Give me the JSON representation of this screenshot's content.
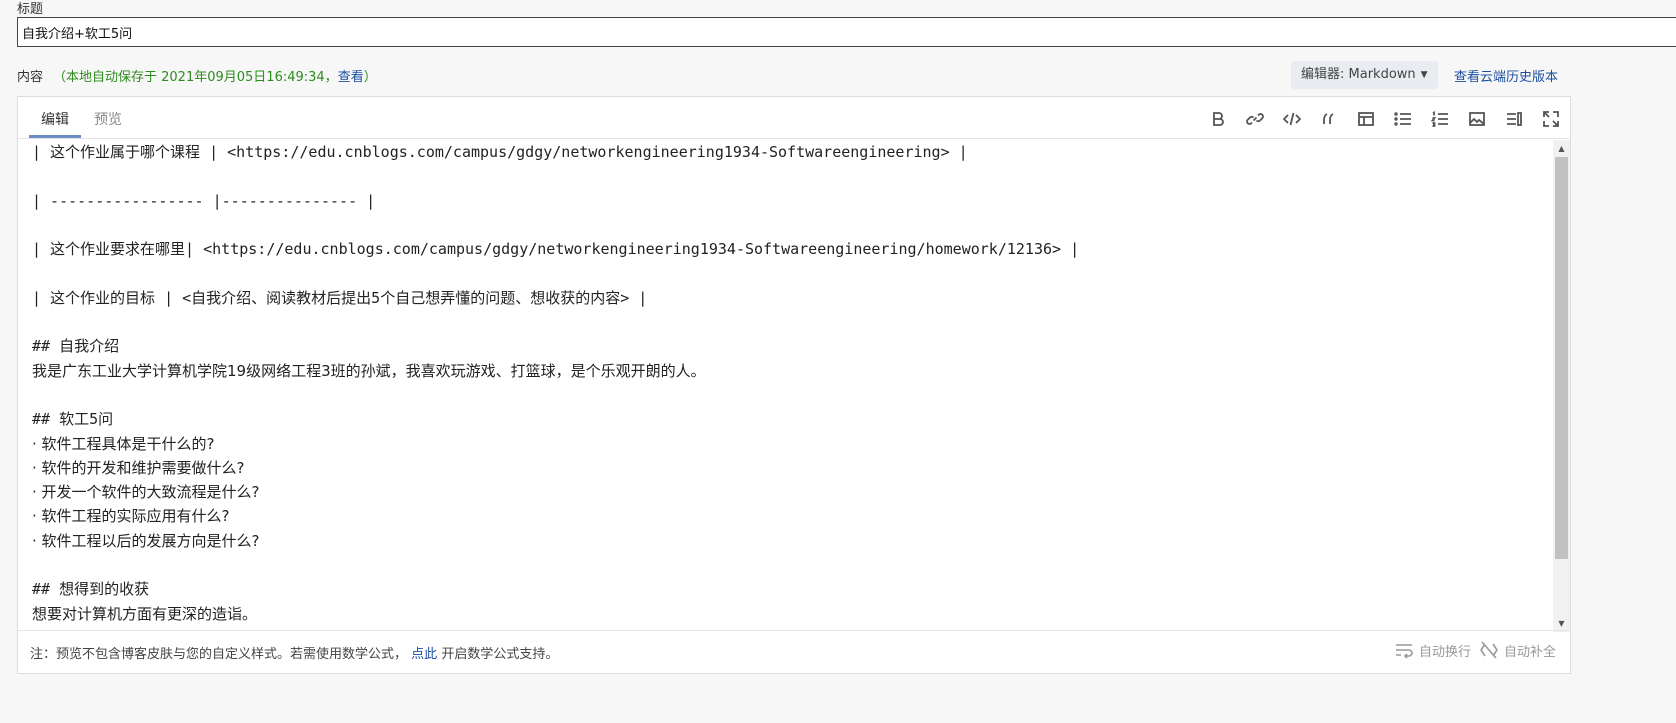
{
  "title_field": {
    "label": "标题",
    "value": "自我介绍+软工5问"
  },
  "content_header": {
    "label": "内容",
    "autosave_prefix": "（本地自动保存于 2021年09月05日16:49:34，",
    "autosave_link": "查看",
    "autosave_suffix": "）",
    "editor_select": "编辑器: Markdown",
    "history_link": "查看云端历史版本"
  },
  "editor": {
    "tabs": [
      {
        "label": "编辑",
        "active": true
      },
      {
        "label": "预览",
        "active": false
      }
    ],
    "toolbar_icons": [
      "bold-icon",
      "link-icon",
      "code-icon",
      "quote-icon",
      "table-icon",
      "bullet-list-icon",
      "numbered-list-icon",
      "image-icon",
      "split-view-icon",
      "fullscreen-icon"
    ],
    "lines": [
      "| 这个作业属于哪个课程 | <https://edu.cnblogs.com/campus/gdgy/networkengineering1934-Softwareengineering> |",
      "",
      "| ----------------- |--------------- |",
      "",
      "| 这个作业要求在哪里| <https://edu.cnblogs.com/campus/gdgy/networkengineering1934-Softwareengineering/homework/12136> |",
      "",
      "| 这个作业的目标 | <自我介绍、阅读教材后提出5个自己想弄懂的问题、想收获的内容> |",
      "",
      "## 自我介绍",
      "我是广东工业大学计算机学院19级网络工程3班的孙斌，我喜欢玩游戏、打篮球，是个乐观开朗的人。",
      "",
      "## 软工5问",
      "· 软件工程具体是干什么的?",
      "· 软件的开发和维护需要做什么?",
      "· 开发一个软件的大致流程是什么?",
      "· 软件工程的实际应用有什么?",
      "· 软件工程以后的发展方向是什么?",
      "",
      "## 想得到的收获",
      "想要对计算机方面有更深的造诣。"
    ],
    "footer": {
      "note_prefix": "注：预览不包含博客皮肤与您的自定义样式。若需使用数学公式，",
      "note_link": "点此",
      "note_suffix": "开启数学公式支持。",
      "wrap_label": "自动换行",
      "autocomplete_label": "自动补全"
    }
  }
}
